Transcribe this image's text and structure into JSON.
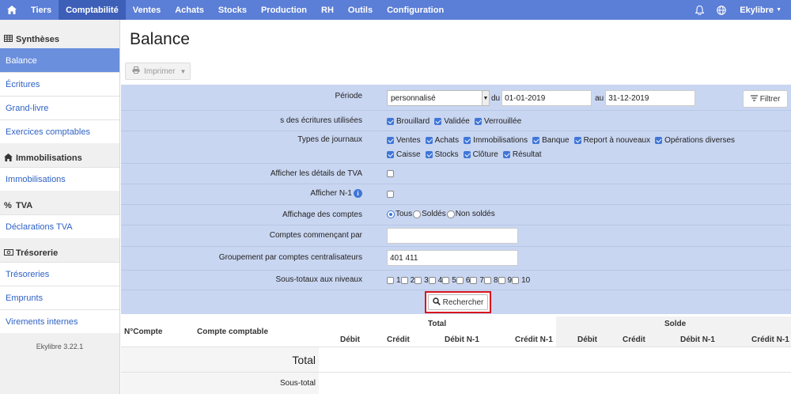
{
  "topnav": {
    "home_icon": "home-icon",
    "items": [
      "Tiers",
      "Comptabilité",
      "Ventes",
      "Achats",
      "Stocks",
      "Production",
      "RH",
      "Outils",
      "Configuration"
    ],
    "active": "Comptabilité",
    "user": "Ekylibre"
  },
  "sidebar": {
    "sections": [
      {
        "title": "Synthèses",
        "icon": "table-icon",
        "items": [
          "Balance",
          "Écritures",
          "Grand-livre",
          "Exercices comptables"
        ]
      },
      {
        "title": "Immobilisations",
        "icon": "home-icon",
        "items": [
          "Immobilisations"
        ]
      },
      {
        "title": "TVA",
        "icon": "percent-icon",
        "items": [
          "Déclarations TVA"
        ]
      },
      {
        "title": "Trésorerie",
        "icon": "money-icon",
        "items": [
          "Trésoreries",
          "Emprunts",
          "Virements internes"
        ]
      }
    ],
    "active_item": "Balance",
    "version": "Ekylibre 3.22.1"
  },
  "main": {
    "title": "Balance",
    "print_label": "Imprimer"
  },
  "filters": {
    "periode_label": "Période",
    "periode_value": "personnalisé",
    "du_label": "du",
    "du_value": "01-01-2019",
    "au_label": "au",
    "au_value": "31-12-2019",
    "filtrer_label": "Filtrer",
    "ecritures_label": "s des écritures utilisées",
    "ecritures": [
      "Brouillard",
      "Validée",
      "Verrouillée"
    ],
    "journaux_label": "Types de journaux",
    "journaux_row1": [
      "Ventes",
      "Achats",
      "Immobilisations",
      "Banque",
      "Report à nouveaux",
      "Opérations diverses"
    ],
    "journaux_row2": [
      "Caisse",
      "Stocks",
      "Clôture",
      "Résultat"
    ],
    "tva_label": "Afficher les détails de TVA",
    "n1_label": "Afficher N-1",
    "affichage_label": "Affichage des comptes",
    "affichage_options": [
      "Tous",
      "Soldés",
      "Non soldés"
    ],
    "comptes_label": "Comptes commençant par",
    "comptes_value": "",
    "groupement_label": "Groupement par comptes centralisateurs",
    "groupement_value": "401 411",
    "soustotaux_label": "Sous-totaux aux niveaux",
    "niveaux": [
      "1",
      "2",
      "3",
      "4",
      "5",
      "6",
      "7",
      "8",
      "9",
      "10"
    ],
    "rechercher_label": "Rechercher"
  },
  "table": {
    "col_numero": "N°Compte",
    "col_compte": "Compte comptable",
    "group_total": "Total",
    "group_solde": "Solde",
    "sub_total": [
      "Débit",
      "Crédit",
      "Débit N-1",
      "Crédit N-1"
    ],
    "sub_solde": [
      "Débit",
      "Crédit",
      "Débit N-1",
      "Crédit N-1"
    ],
    "row_total": "Total",
    "row_soustotal": "Sous-total"
  }
}
